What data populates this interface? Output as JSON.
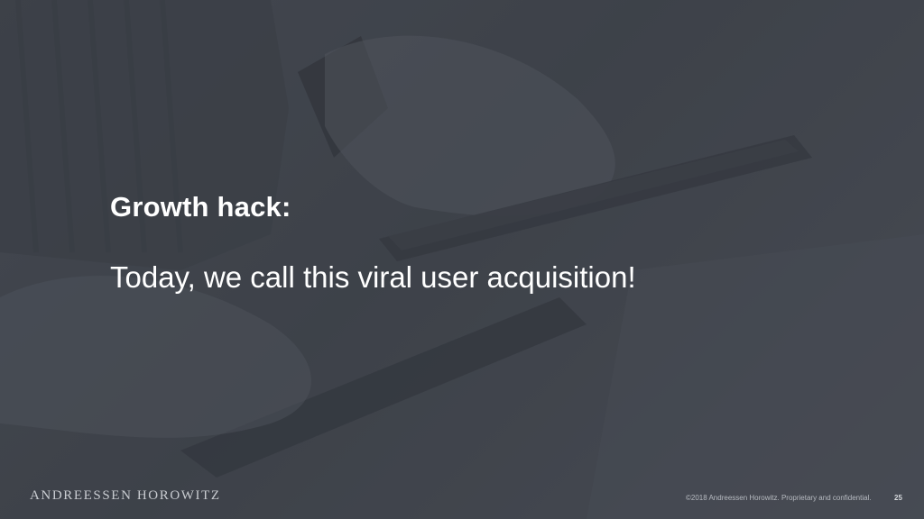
{
  "slide": {
    "headline": "Growth hack:",
    "subline": "Today, we call this viral user acquisition!",
    "logo": "ANDREESSEN HOROWITZ",
    "footer": "©2018 Andreessen Horowitz. Proprietary and confidential.",
    "page_number": "25"
  },
  "colors": {
    "background": "#3f444c",
    "text": "#ffffff"
  }
}
